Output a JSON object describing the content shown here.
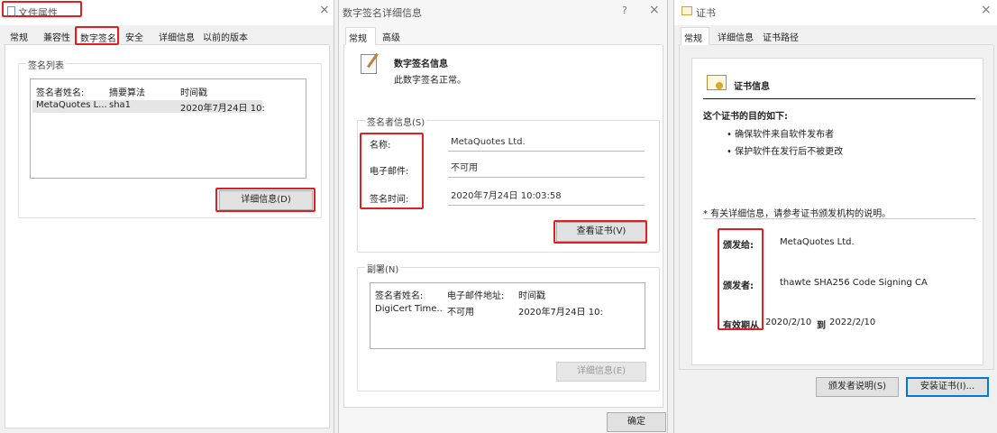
{
  "w1": {
    "title": "文件属性",
    "tabs": [
      "常规",
      "兼容性",
      "数字签名",
      "安全",
      "详细信息",
      "以前的版本"
    ],
    "group_label": "签名列表",
    "columns": [
      "签名者姓名:",
      "摘要算法",
      "时间戳"
    ],
    "row": [
      "MetaQuotes L...",
      "sha1",
      "2020年7月24日 10:..."
    ],
    "details_button": "详细信息(D)"
  },
  "w2": {
    "title": "数字签名详细信息",
    "help": "?",
    "tabs": [
      "常规",
      "高级"
    ],
    "heading": "数字签名信息",
    "subtext": "此数字签名正常。",
    "group_label": "签名者信息(S)",
    "name_label": "名称:",
    "name_value": "MetaQuotes Ltd.",
    "email_label": "电子邮件:",
    "email_value": "不可用",
    "time_label": "签名时间:",
    "time_value": "2020年7月24日 10:03:58",
    "view_cert_button": "查看证书(V)",
    "countersig_label": "副署(N)",
    "countersig_columns": [
      "签名者姓名:",
      "电子邮件地址:",
      "时间戳"
    ],
    "countersig_row": [
      "DigiCert Time...",
      "不可用",
      "2020年7月24日 10:..."
    ],
    "countersig_details_button": "详细信息(E)",
    "ok_button": "确定"
  },
  "w3": {
    "title": "证书",
    "tabs": [
      "常规",
      "详细信息",
      "证书路径"
    ],
    "heading": "证书信息",
    "purpose_title": "这个证书的目的如下:",
    "purposes": [
      "确保软件来自软件发布者",
      "保护软件在发行后不被更改"
    ],
    "note": "* 有关详细信息，请参考证书颁发机构的说明。",
    "issued_to_label": "颁发给:",
    "issued_to_value": "MetaQuotes Ltd.",
    "issued_by_label": "颁发者:",
    "issued_by_value": "thawte SHA256 Code Signing CA",
    "valid_label": "有效期从",
    "valid_from": "2020/2/10",
    "valid_to_word": "到",
    "valid_to": "2022/2/10",
    "issuer_statement_button": "颁发者说明(S)",
    "install_button": "安装证书(I)..."
  },
  "colors": {
    "highlight": "#e02020",
    "accent": "#0078d7"
  }
}
